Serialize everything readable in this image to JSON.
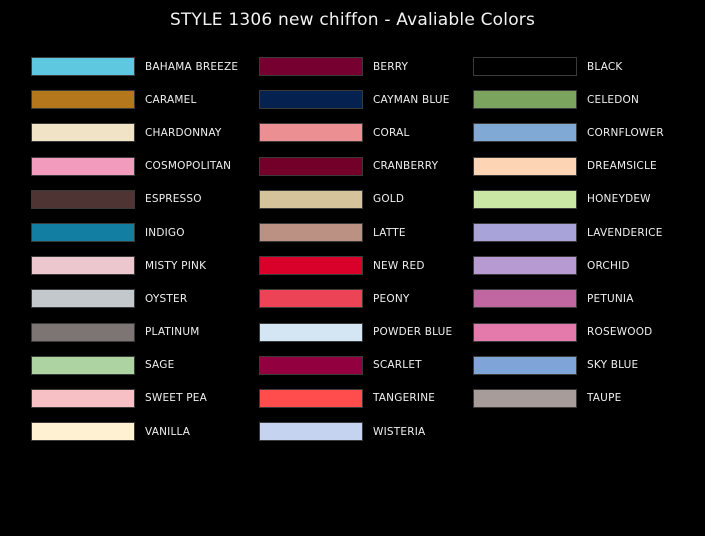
{
  "title": "STYLE 1306 new chiffon - Avaliable Colors",
  "columns": [
    [
      {
        "name": "BAHAMA BREEZE",
        "color": "#5ec8e0"
      },
      {
        "name": "CARAMEL",
        "color": "#b5771c"
      },
      {
        "name": "CHARDONNAY",
        "color": "#f1e3c6"
      },
      {
        "name": "COSMOPOLITAN",
        "color": "#f29bbd"
      },
      {
        "name": "ESPRESSO",
        "color": "#4e3533"
      },
      {
        "name": "INDIGO",
        "color": "#127ea2"
      },
      {
        "name": "MISTY PINK",
        "color": "#ecc7ce"
      },
      {
        "name": "OYSTER",
        "color": "#c3c8cc"
      },
      {
        "name": "PLATINUM",
        "color": "#7d7573"
      },
      {
        "name": "SAGE",
        "color": "#acd3a1"
      },
      {
        "name": "SWEET PEA",
        "color": "#f6c0c4"
      },
      {
        "name": "VANILLA",
        "color": "#fff1d1"
      }
    ],
    [
      {
        "name": "BERRY",
        "color": "#760030"
      },
      {
        "name": "CAYMAN BLUE",
        "color": "#04214f"
      },
      {
        "name": "CORAL",
        "color": "#ec8f93"
      },
      {
        "name": "CRANBERRY",
        "color": "#720028"
      },
      {
        "name": "GOLD",
        "color": "#d5c49b"
      },
      {
        "name": "LATTE",
        "color": "#bb9184"
      },
      {
        "name": "NEW RED",
        "color": "#d9002a"
      },
      {
        "name": "PEONY",
        "color": "#ec4356"
      },
      {
        "name": "POWDER BLUE",
        "color": "#d4e5f3"
      },
      {
        "name": "SCARLET",
        "color": "#93003f"
      },
      {
        "name": "TANGERINE",
        "color": "#fe4d4c"
      },
      {
        "name": "WISTERIA",
        "color": "#c5d3f0"
      }
    ],
    [
      {
        "name": "BLACK",
        "color": "#000000"
      },
      {
        "name": "CELEDON",
        "color": "#7ba45f"
      },
      {
        "name": "CORNFLOWER",
        "color": "#80aad5"
      },
      {
        "name": "DREAMSICLE",
        "color": "#fdd5b5"
      },
      {
        "name": "HONEYDEW",
        "color": "#cbe7a4"
      },
      {
        "name": "LAVENDERICE",
        "color": "#a8a3d8"
      },
      {
        "name": "ORCHID",
        "color": "#b89ad2"
      },
      {
        "name": "PETUNIA",
        "color": "#c067a1"
      },
      {
        "name": "ROSEWOOD",
        "color": "#e479ac"
      },
      {
        "name": "SKY BLUE",
        "color": "#7ea4d8"
      },
      {
        "name": "TAUPE",
        "color": "#a89c9a"
      }
    ]
  ]
}
